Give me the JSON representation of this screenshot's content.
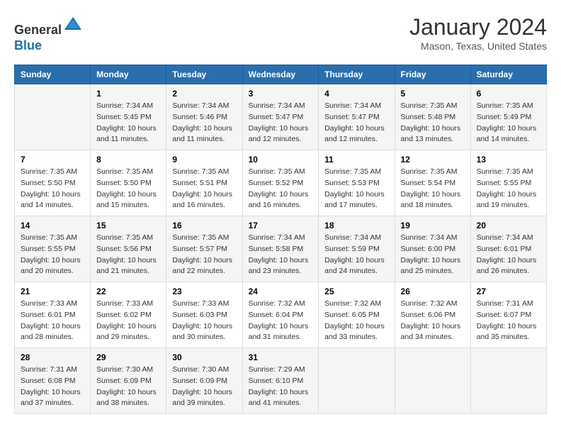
{
  "header": {
    "logo_line1": "General",
    "logo_line2": "Blue",
    "main_title": "January 2024",
    "subtitle": "Mason, Texas, United States"
  },
  "weekdays": [
    "Sunday",
    "Monday",
    "Tuesday",
    "Wednesday",
    "Thursday",
    "Friday",
    "Saturday"
  ],
  "weeks": [
    [
      {
        "day": "",
        "sunrise": "",
        "sunset": "",
        "daylight": ""
      },
      {
        "day": "1",
        "sunrise": "Sunrise: 7:34 AM",
        "sunset": "Sunset: 5:45 PM",
        "daylight": "Daylight: 10 hours and 11 minutes."
      },
      {
        "day": "2",
        "sunrise": "Sunrise: 7:34 AM",
        "sunset": "Sunset: 5:46 PM",
        "daylight": "Daylight: 10 hours and 11 minutes."
      },
      {
        "day": "3",
        "sunrise": "Sunrise: 7:34 AM",
        "sunset": "Sunset: 5:47 PM",
        "daylight": "Daylight: 10 hours and 12 minutes."
      },
      {
        "day": "4",
        "sunrise": "Sunrise: 7:34 AM",
        "sunset": "Sunset: 5:47 PM",
        "daylight": "Daylight: 10 hours and 12 minutes."
      },
      {
        "day": "5",
        "sunrise": "Sunrise: 7:35 AM",
        "sunset": "Sunset: 5:48 PM",
        "daylight": "Daylight: 10 hours and 13 minutes."
      },
      {
        "day": "6",
        "sunrise": "Sunrise: 7:35 AM",
        "sunset": "Sunset: 5:49 PM",
        "daylight": "Daylight: 10 hours and 14 minutes."
      }
    ],
    [
      {
        "day": "7",
        "sunrise": "Sunrise: 7:35 AM",
        "sunset": "Sunset: 5:50 PM",
        "daylight": "Daylight: 10 hours and 14 minutes."
      },
      {
        "day": "8",
        "sunrise": "Sunrise: 7:35 AM",
        "sunset": "Sunset: 5:50 PM",
        "daylight": "Daylight: 10 hours and 15 minutes."
      },
      {
        "day": "9",
        "sunrise": "Sunrise: 7:35 AM",
        "sunset": "Sunset: 5:51 PM",
        "daylight": "Daylight: 10 hours and 16 minutes."
      },
      {
        "day": "10",
        "sunrise": "Sunrise: 7:35 AM",
        "sunset": "Sunset: 5:52 PM",
        "daylight": "Daylight: 10 hours and 16 minutes."
      },
      {
        "day": "11",
        "sunrise": "Sunrise: 7:35 AM",
        "sunset": "Sunset: 5:53 PM",
        "daylight": "Daylight: 10 hours and 17 minutes."
      },
      {
        "day": "12",
        "sunrise": "Sunrise: 7:35 AM",
        "sunset": "Sunset: 5:54 PM",
        "daylight": "Daylight: 10 hours and 18 minutes."
      },
      {
        "day": "13",
        "sunrise": "Sunrise: 7:35 AM",
        "sunset": "Sunset: 5:55 PM",
        "daylight": "Daylight: 10 hours and 19 minutes."
      }
    ],
    [
      {
        "day": "14",
        "sunrise": "Sunrise: 7:35 AM",
        "sunset": "Sunset: 5:55 PM",
        "daylight": "Daylight: 10 hours and 20 minutes."
      },
      {
        "day": "15",
        "sunrise": "Sunrise: 7:35 AM",
        "sunset": "Sunset: 5:56 PM",
        "daylight": "Daylight: 10 hours and 21 minutes."
      },
      {
        "day": "16",
        "sunrise": "Sunrise: 7:35 AM",
        "sunset": "Sunset: 5:57 PM",
        "daylight": "Daylight: 10 hours and 22 minutes."
      },
      {
        "day": "17",
        "sunrise": "Sunrise: 7:34 AM",
        "sunset": "Sunset: 5:58 PM",
        "daylight": "Daylight: 10 hours and 23 minutes."
      },
      {
        "day": "18",
        "sunrise": "Sunrise: 7:34 AM",
        "sunset": "Sunset: 5:59 PM",
        "daylight": "Daylight: 10 hours and 24 minutes."
      },
      {
        "day": "19",
        "sunrise": "Sunrise: 7:34 AM",
        "sunset": "Sunset: 6:00 PM",
        "daylight": "Daylight: 10 hours and 25 minutes."
      },
      {
        "day": "20",
        "sunrise": "Sunrise: 7:34 AM",
        "sunset": "Sunset: 6:01 PM",
        "daylight": "Daylight: 10 hours and 26 minutes."
      }
    ],
    [
      {
        "day": "21",
        "sunrise": "Sunrise: 7:33 AM",
        "sunset": "Sunset: 6:01 PM",
        "daylight": "Daylight: 10 hours and 28 minutes."
      },
      {
        "day": "22",
        "sunrise": "Sunrise: 7:33 AM",
        "sunset": "Sunset: 6:02 PM",
        "daylight": "Daylight: 10 hours and 29 minutes."
      },
      {
        "day": "23",
        "sunrise": "Sunrise: 7:33 AM",
        "sunset": "Sunset: 6:03 PM",
        "daylight": "Daylight: 10 hours and 30 minutes."
      },
      {
        "day": "24",
        "sunrise": "Sunrise: 7:32 AM",
        "sunset": "Sunset: 6:04 PM",
        "daylight": "Daylight: 10 hours and 31 minutes."
      },
      {
        "day": "25",
        "sunrise": "Sunrise: 7:32 AM",
        "sunset": "Sunset: 6:05 PM",
        "daylight": "Daylight: 10 hours and 33 minutes."
      },
      {
        "day": "26",
        "sunrise": "Sunrise: 7:32 AM",
        "sunset": "Sunset: 6:06 PM",
        "daylight": "Daylight: 10 hours and 34 minutes."
      },
      {
        "day": "27",
        "sunrise": "Sunrise: 7:31 AM",
        "sunset": "Sunset: 6:07 PM",
        "daylight": "Daylight: 10 hours and 35 minutes."
      }
    ],
    [
      {
        "day": "28",
        "sunrise": "Sunrise: 7:31 AM",
        "sunset": "Sunset: 6:08 PM",
        "daylight": "Daylight: 10 hours and 37 minutes."
      },
      {
        "day": "29",
        "sunrise": "Sunrise: 7:30 AM",
        "sunset": "Sunset: 6:09 PM",
        "daylight": "Daylight: 10 hours and 38 minutes."
      },
      {
        "day": "30",
        "sunrise": "Sunrise: 7:30 AM",
        "sunset": "Sunset: 6:09 PM",
        "daylight": "Daylight: 10 hours and 39 minutes."
      },
      {
        "day": "31",
        "sunrise": "Sunrise: 7:29 AM",
        "sunset": "Sunset: 6:10 PM",
        "daylight": "Daylight: 10 hours and 41 minutes."
      },
      {
        "day": "",
        "sunrise": "",
        "sunset": "",
        "daylight": ""
      },
      {
        "day": "",
        "sunrise": "",
        "sunset": "",
        "daylight": ""
      },
      {
        "day": "",
        "sunrise": "",
        "sunset": "",
        "daylight": ""
      }
    ]
  ]
}
